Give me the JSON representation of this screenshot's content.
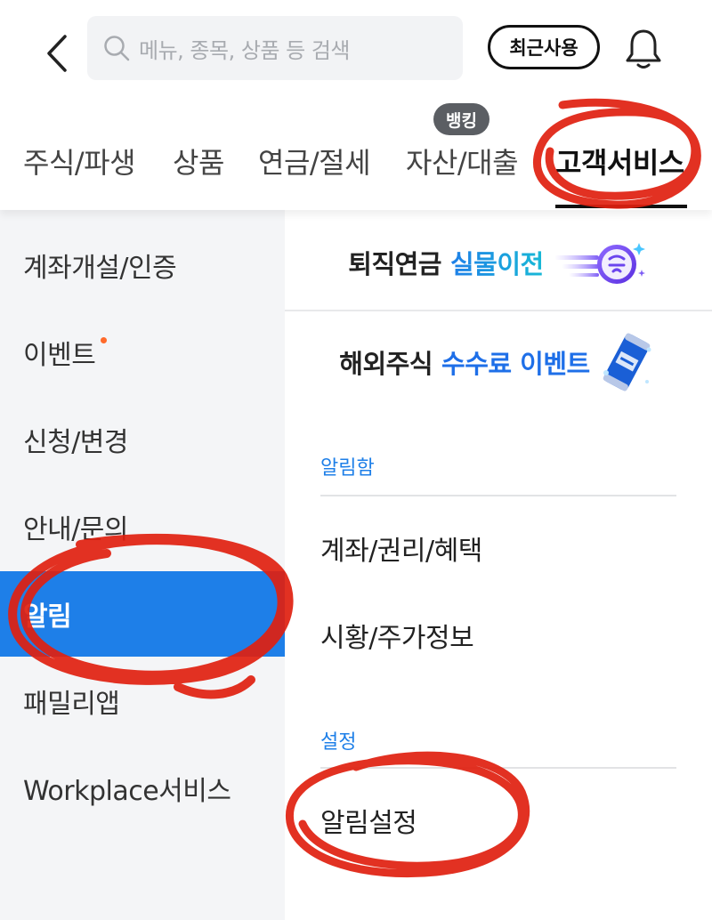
{
  "search": {
    "placeholder": "메뉴, 종목, 상품 등 검색"
  },
  "header": {
    "recent_label": "최근사용"
  },
  "tabs": [
    {
      "label": "주식/파생"
    },
    {
      "label": "상품"
    },
    {
      "label": "연금/절세"
    },
    {
      "label": "자산/대출",
      "badge": "뱅킹"
    },
    {
      "label": "고객서비스",
      "active": true
    }
  ],
  "sidebar": {
    "items": [
      {
        "label": "계좌개설/인증"
      },
      {
        "label": "이벤트",
        "new_dot": true
      },
      {
        "label": "신청/변경"
      },
      {
        "label": "안내/문의"
      },
      {
        "label": "알림",
        "active": true
      },
      {
        "label": "패밀리앱"
      },
      {
        "label": "Workplace서비스"
      }
    ]
  },
  "banners": [
    {
      "text": "퇴직연금",
      "highlight": "실물이전",
      "icon": "sparkle-badge-icon"
    },
    {
      "text": "해외주식",
      "highlight": "수수료 이벤트",
      "icon": "soda-can-icon"
    }
  ],
  "sections": [
    {
      "title": "알림함",
      "items": [
        "계좌/권리/혜택",
        "시황/주가정보"
      ]
    },
    {
      "title": "설정",
      "items": [
        "알림설정"
      ]
    }
  ],
  "colors": {
    "accent_blue": "#1e7fe8",
    "badge_gray": "#5b5e63",
    "dot_orange": "#ff6a2b",
    "annotation_red": "#e0200f",
    "sidebar_bg": "#f4f5f7"
  }
}
